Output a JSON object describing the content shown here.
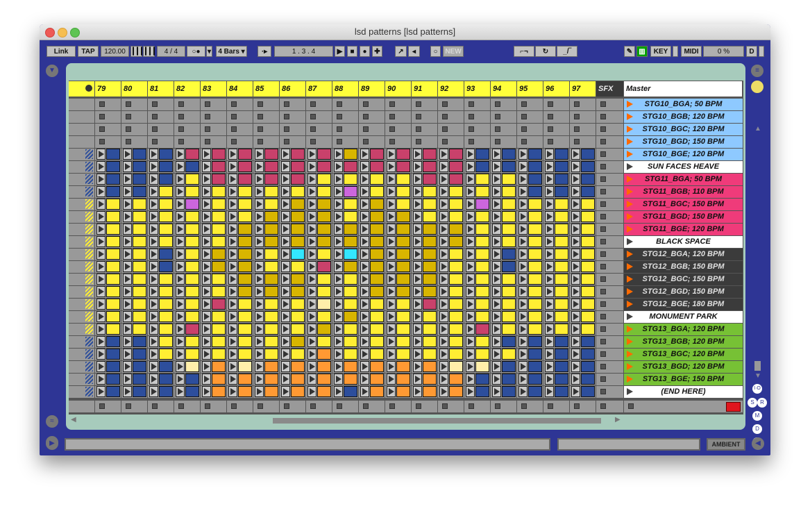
{
  "window": {
    "title": "lsd patterns  [lsd patterns]"
  },
  "toolbar": {
    "link": "Link",
    "tap": "TAP",
    "tempo": "120.00",
    "sig": "4 / 4",
    "quant": "4 Bars ▾",
    "position": "1 .   3 .   4",
    "new": "NEW",
    "key": "KEY",
    "midi": "MIDI",
    "cpu": "0 %",
    "d": "D"
  },
  "tracks": [
    "79",
    "80",
    "81",
    "82",
    "83",
    "84",
    "85",
    "86",
    "87",
    "88",
    "89",
    "90",
    "91",
    "92",
    "93",
    "94",
    "95",
    "96",
    "97"
  ],
  "sfx": "SFX",
  "master": "Master",
  "scenes": [
    {
      "name": "STG10_BGA; 50 BPM",
      "bg": "#8ec9ff",
      "tri": "orange"
    },
    {
      "name": "STG10_BGB; 120 BPM",
      "bg": "#8ec9ff",
      "tri": "orange"
    },
    {
      "name": "STG10_BGC; 120 BPM",
      "bg": "#8ec9ff",
      "tri": "orange"
    },
    {
      "name": "STG10_BGD; 150 BPM",
      "bg": "#8ec9ff",
      "tri": "orange"
    },
    {
      "name": "STG10_BGE; 120 BPM",
      "bg": "#8ec9ff",
      "tri": "orange"
    },
    {
      "name": "SUN FACES HEAVE",
      "bg": "#ffffff",
      "tri": "dark"
    },
    {
      "name": "STG11_BGA; 50 BPM",
      "bg": "#ef3b7a",
      "tri": "orange"
    },
    {
      "name": "STG11_BGB; 110 BPM",
      "bg": "#ef3b7a",
      "tri": "orange"
    },
    {
      "name": "STG11_BGC; 150 BPM",
      "bg": "#ef3b7a",
      "tri": "orange"
    },
    {
      "name": "STG11_BGD; 150 BPM",
      "bg": "#ef3b7a",
      "tri": "orange"
    },
    {
      "name": "STG11_BGE; 120 BPM",
      "bg": "#ef3b7a",
      "tri": "orange"
    },
    {
      "name": "BLACK SPACE",
      "bg": "#ffffff",
      "tri": "dark"
    },
    {
      "name": "STG12_BGA; 120 BPM",
      "bg": "#3b3b3b",
      "tri": "orange",
      "fg": "#e0e0e0"
    },
    {
      "name": "STG12_BGB; 150 BPM",
      "bg": "#3b3b3b",
      "tri": "orange",
      "fg": "#e0e0e0"
    },
    {
      "name": "STG12_BGC; 150 BPM",
      "bg": "#3b3b3b",
      "tri": "orange",
      "fg": "#e0e0e0"
    },
    {
      "name": "STG12_BGD; 150 BPM",
      "bg": "#3b3b3b",
      "tri": "orange",
      "fg": "#e0e0e0"
    },
    {
      "name": "STG12_BGE; 180 BPM",
      "bg": "#3b3b3b",
      "tri": "orange",
      "fg": "#e0e0e0"
    },
    {
      "name": "MONUMENT PARK",
      "bg": "#ffffff",
      "tri": "dark"
    },
    {
      "name": "STG13_BGA; 120 BPM",
      "bg": "#77c135",
      "tri": "orange"
    },
    {
      "name": "STG13_BGB; 120 BPM",
      "bg": "#77c135",
      "tri": "orange"
    },
    {
      "name": "STG13_BGC; 120 BPM",
      "bg": "#77c135",
      "tri": "orange"
    },
    {
      "name": "STG13_BGD; 120 BPM",
      "bg": "#77c135",
      "tri": "orange"
    },
    {
      "name": "STG13_BGE; 150 BPM",
      "bg": "#77c135",
      "tri": "orange"
    },
    {
      "name": "(END HERE)",
      "bg": "#ffffff",
      "tri": "dark"
    }
  ],
  "palette": {
    "B": "#2d4e9c",
    "Y": "#ffee33",
    "O": "#d8b500",
    "P": "#c9416b",
    "M": "#cc66dd",
    "C": "#33e6ff",
    "R": "#ff9933",
    "L": "#ffeeaa",
    "G": "#c9c9c9"
  },
  "clips": [
    "...................",
    "...................",
    "...................",
    "...................",
    "BBBPPPPPPOPPPPBBBBB",
    "BBBBPPPPPPPPPPBBBBB",
    "BBBYPPPPYYYYPPYYBBB",
    "BBYYYYYYYMYYYYYYBBB",
    "YYYMYYYOOYOYYYMYYYY",
    "YYYYYYOOOYOOYYYYYYY",
    "YYYYYOOOOOOOOOYYYYY",
    "YYYYYOOOOOOOOOYYYYY",
    "YYBYOOYCYCOOOYYBYYY",
    "YYBYOOYYPOOOOYYBYYY",
    "YYYYYOOOYYOOOYYYYYY",
    "YYYYYOOOYYOOOYYYYYY",
    "YYYYPYYYLYYYPYYYYYY",
    "YYYYYYYYYOYYYYYYYYY",
    "YYYPYYYYOYYYYYPYYYY",
    "BBYYYYYOYYYYYYYBBBB",
    "BBYYYYYYRYYYYYYYBBB",
    "BBBLRLRRRRRRRLLBBBB",
    "BBBBRRRRRRRRRRBBBBB",
    "BBBBRRRRRBRRRRBBBBB"
  ],
  "bottom": {
    "ambient": "AMBIENT"
  }
}
